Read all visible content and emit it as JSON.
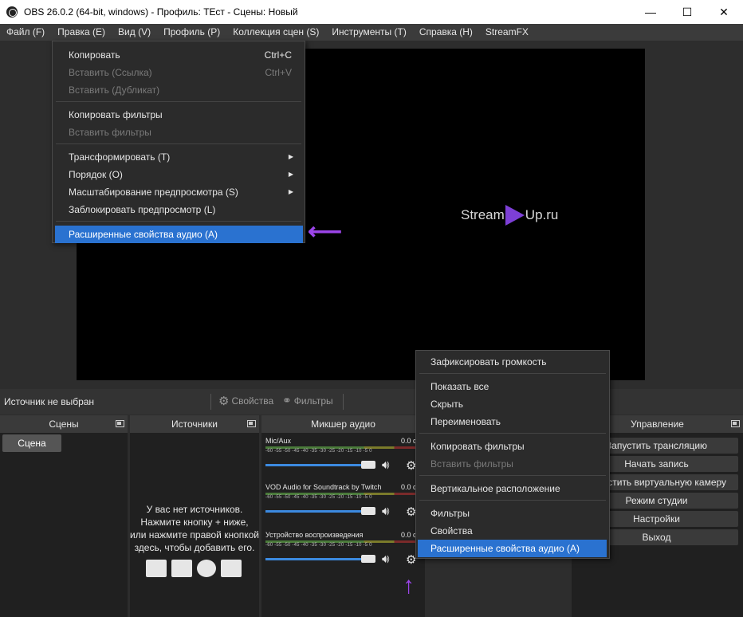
{
  "window": {
    "title": "OBS 26.0.2 (64-bit, windows) - Профиль: ТЕст - Сцены: Новый",
    "minimize": "—",
    "maximize": "☐",
    "close": "✕"
  },
  "menubar": [
    "Файл (F)",
    "Правка (E)",
    "Вид (V)",
    "Профиль (P)",
    "Коллекция сцен (S)",
    "Инструменты (T)",
    "Справка (H)",
    "StreamFX"
  ],
  "edit_menu": {
    "items": [
      {
        "label": "Копировать",
        "shortcut": "Ctrl+C",
        "disabled": false
      },
      {
        "label": "Вставить (Ссылка)",
        "shortcut": "Ctrl+V",
        "disabled": true
      },
      {
        "label": "Вставить (Дубликат)",
        "shortcut": "",
        "disabled": true
      },
      {
        "label": "Копировать фильтры",
        "disabled": false
      },
      {
        "label": "Вставить фильтры",
        "disabled": true
      },
      {
        "label": "Трансформировать (T)",
        "submenu": true
      },
      {
        "label": "Порядок (O)",
        "submenu": true
      },
      {
        "label": "Масштабирование предпросмотра (S)",
        "submenu": true
      },
      {
        "label": "Заблокировать предпросмотр (L)"
      },
      {
        "label": "Расширенные свойства аудио (A)",
        "selected": true
      }
    ]
  },
  "preview": {
    "logo_left": "Stream",
    "logo_right": "Up.ru",
    "accent": "#7d3fd6"
  },
  "source_toolbar": {
    "status": "Источник не выбран",
    "properties": "Свойства",
    "filters": "Фильтры"
  },
  "docks": {
    "scenes": {
      "title": "Сцены",
      "items": [
        "Сцена"
      ]
    },
    "sources": {
      "title": "Источники",
      "empty_lines": [
        "У вас нет источников.",
        "Нажмите кнопку + ниже,",
        "или нажмите правой кнопкой",
        "здесь, чтобы добавить его."
      ]
    },
    "mixer": {
      "title": "Микшер аудио",
      "ticks": "-60 -55 -50 -45 -40 -35 -30 -25 -20 -15 -10 -5 0",
      "channels": [
        {
          "name": "Mic/Aux",
          "value": "0.0 d"
        },
        {
          "name": "VOD Audio for Soundtrack by Twitch",
          "value": "0.0 d"
        },
        {
          "name": "Устройство воспроизведения",
          "value": "0.0 d"
        }
      ]
    },
    "controls": {
      "title": "Управление",
      "buttons": [
        "Запустить трансляцию",
        "Начать запись",
        "Запустить виртуальную камеру",
        "Режим студии",
        "Настройки",
        "Выход"
      ]
    }
  },
  "context_menu": {
    "items": [
      {
        "label": "Зафиксировать громкость"
      },
      {
        "label": "Показать все"
      },
      {
        "label": "Скрыть"
      },
      {
        "label": "Переименовать"
      },
      {
        "label": "Копировать фильтры"
      },
      {
        "label": "Вставить фильтры",
        "disabled": true
      },
      {
        "label": "Вертикальное расположение"
      },
      {
        "label": "Фильтры"
      },
      {
        "label": "Свойства"
      },
      {
        "label": "Расширенные свойства аудио (A)",
        "selected": true
      }
    ]
  },
  "icons": {
    "arrow_left": "arrow-left-icon",
    "arrow_up": "arrow-up-icon",
    "gear": "gear-icon",
    "speaker": "speaker-icon"
  },
  "colors": {
    "selected": "#2a72d0",
    "annotation": "#9b45e8",
    "volume": "#3c8ae0"
  }
}
